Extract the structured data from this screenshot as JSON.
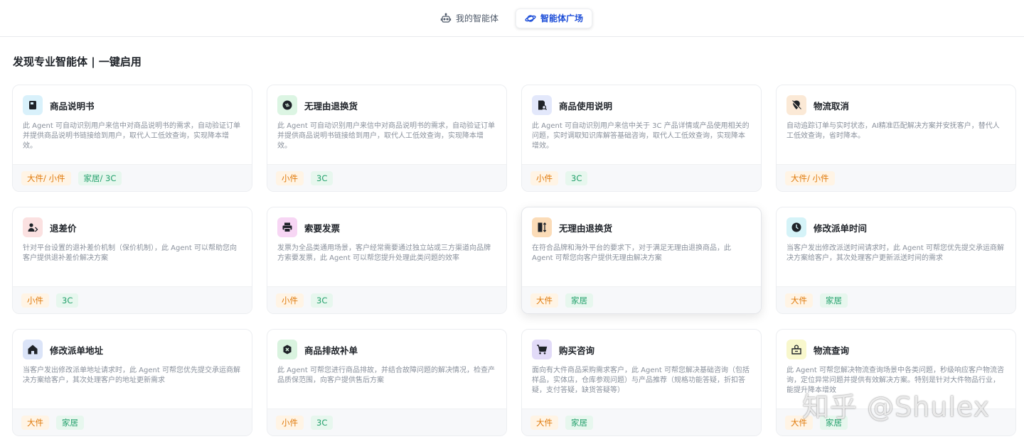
{
  "header": {
    "tabs": [
      {
        "label": "我的智能体",
        "icon": "robot-icon",
        "active": false
      },
      {
        "label": "智能体广场",
        "icon": "planet-icon",
        "active": true
      }
    ]
  },
  "page": {
    "heading": "发现专业智能体 | 一键启用"
  },
  "cards": [
    {
      "title": "商品说明书",
      "icon": "book-icon",
      "icon_bg": "#d9f1fb",
      "icon_color": "#1f2329",
      "desc": "此 Agent 可自动识别用户来信中对商品说明书的需求，自动验证订单并提供商品说明书链接给到用户，取代人工低效查询，实现降本增效。",
      "tags": [
        {
          "text": "大件/ 小件",
          "color": "orange"
        },
        {
          "text": "家居/ 3C",
          "color": "green"
        }
      ]
    },
    {
      "title": "无理由退换货",
      "icon": "exchange-icon",
      "icon_bg": "#dcf5e3",
      "icon_color": "#1f2329",
      "desc": "此 Agent 可自动识别用户来信中对商品说明书的需求，自动验证订单并提供商品说明书链接给到用户，取代人工低效查询，实现降本增效。",
      "tags": [
        {
          "text": "小件",
          "color": "orange"
        },
        {
          "text": "3C",
          "color": "green"
        }
      ]
    },
    {
      "title": "商品使用说明",
      "icon": "doc-search-icon",
      "icon_bg": "#e3e8fb",
      "icon_color": "#1f2329",
      "desc": "此 Agent 可自动识别用户来信中关于 3C 产品详情或产品使用相关的问题，实时调取知识库解答基础咨询，取代人工低效查询，实现降本增效。",
      "tags": [
        {
          "text": "小件",
          "color": "orange"
        },
        {
          "text": "3C",
          "color": "green"
        }
      ]
    },
    {
      "title": "物流取消",
      "icon": "location-off-icon",
      "icon_bg": "#fbe9d6",
      "icon_color": "#1f2329",
      "desc": "自动追踪订单与实时状态，AI精准匹配解决方案并安抚客户，替代人工低效查询，省时降本。",
      "tags": [
        {
          "text": "大件/ 小件",
          "color": "orange"
        }
      ]
    },
    {
      "title": "退差价",
      "icon": "person-refund-icon",
      "icon_bg": "#fbe1e1",
      "icon_color": "#1f2329",
      "desc": "针对平台设置的退补差价机制（保价机制），此 Agent 可以帮助您向客户提供退补差价解决方案",
      "tags": [
        {
          "text": "小件",
          "color": "orange"
        },
        {
          "text": "3C",
          "color": "green"
        }
      ]
    },
    {
      "title": "索要发票",
      "icon": "printer-icon",
      "icon_bg": "#f7d6f4",
      "icon_color": "#1f2329",
      "desc": "发票为全品类通用场景，客户经常需要通过独立站或三方渠道向品牌方索要发票，此 Agent 可以帮您提升处理此类问题的效率",
      "tags": [
        {
          "text": "小件",
          "color": "orange"
        },
        {
          "text": "3C",
          "color": "green"
        }
      ]
    },
    {
      "title": "无理由退换货",
      "icon": "door-arrows-icon",
      "icon_bg": "#fbdcb8",
      "icon_color": "#1f2329",
      "desc": "在符合品牌和海外平台的要求下，对于满足无理由退换商品，此 Agent 可帮您向客户提供无理由解决方案",
      "tags": [
        {
          "text": "大件",
          "color": "orange"
        },
        {
          "text": "家居",
          "color": "green"
        }
      ],
      "highlight": true
    },
    {
      "title": "修改派单时间",
      "icon": "clock-icon",
      "icon_bg": "#d5f3f8",
      "icon_color": "#1f2329",
      "desc": "当客户发出修改派送时间请求时，此 Agent 可帮您优先提交承运商解决方案给客户，其次处理客户更新派送时间的需求",
      "tags": [
        {
          "text": "大件",
          "color": "orange"
        },
        {
          "text": "家居",
          "color": "green"
        }
      ]
    },
    {
      "title": "修改派单地址",
      "icon": "home-icon",
      "icon_bg": "#dbe4f8",
      "icon_color": "#1f2329",
      "desc": "当客户发出修改派单地址请求时，此 Agent 可帮您优先提交承运商解决方案给客户，其次处理客户的地址更新需求",
      "tags": [
        {
          "text": "大件",
          "color": "orange"
        },
        {
          "text": "家居",
          "color": "green"
        }
      ]
    },
    {
      "title": "商品排故补单",
      "icon": "tool-icon",
      "icon_bg": "#d9f3df",
      "icon_color": "#1f2329",
      "desc": "此 Agent 可帮您进行商品排故，并结合故障问题的解决情况，检查产品质保范围，向客户提供售后方案",
      "tags": [
        {
          "text": "小件",
          "color": "orange"
        },
        {
          "text": "3C",
          "color": "green"
        }
      ]
    },
    {
      "title": "购买咨询",
      "icon": "cart-icon",
      "icon_bg": "#e2dbf8",
      "icon_color": "#1f2329",
      "desc": "面向有大件商品采购需求客户，此 Agent 可帮您解决基础咨询（包括样品，实体店，仓库参观问题）与产品推荐（规格功能答疑，折扣答疑，支付答疑，缺货答疑等）",
      "tags": [
        {
          "text": "大件",
          "color": "orange"
        },
        {
          "text": "家居",
          "color": "green"
        }
      ]
    },
    {
      "title": "物流查询",
      "icon": "package-search-icon",
      "icon_bg": "#f8f7cc",
      "icon_color": "#1f2329",
      "desc": "此 Agent 可帮您解决物流查询场景中各类问题，秒级响应客户物流咨询，定位异常问题并提供有效解决方案。特别是针对大件物品行业，能提升降本增效",
      "tags": [
        {
          "text": "大件",
          "color": "orange"
        },
        {
          "text": "家居",
          "color": "green"
        }
      ]
    }
  ],
  "watermark": "知乎 @Shulex"
}
